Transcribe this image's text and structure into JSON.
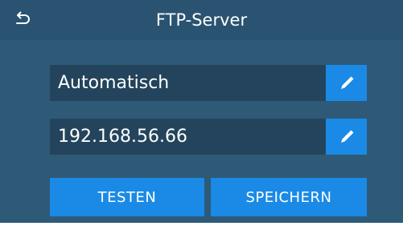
{
  "header": {
    "title": "FTP-Server",
    "back_icon": "back-arrow-icon"
  },
  "fields": [
    {
      "value": "Automatisch",
      "edit_icon": "pencil-icon"
    },
    {
      "value": "192.168.56.66",
      "edit_icon": "pencil-icon"
    }
  ],
  "actions": {
    "test_label": "TESTEN",
    "save_label": "SPEICHERN"
  },
  "colors": {
    "background": "#2e5a78",
    "header": "#2a5371",
    "field": "#23445c",
    "accent": "#1a8ae6",
    "text": "#ffffff"
  }
}
